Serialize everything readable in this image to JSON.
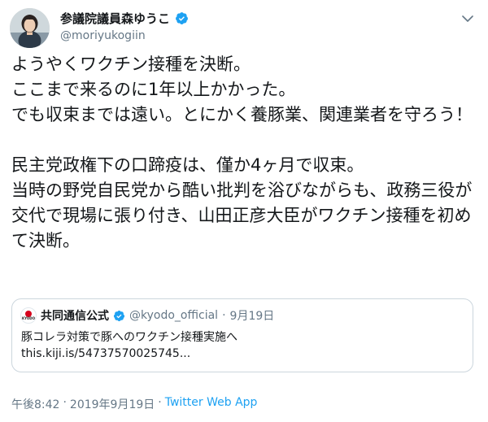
{
  "author": {
    "display_name": "参議院議員森ゆうこ",
    "handle": "@moriyukogiin"
  },
  "tweet": {
    "paragraphs": [
      "ようやくワクチン接種を決断。\nここまで来るのに1年以上かかった。\nでも収束までは遠い。とにかく養豚業、関連業者を守ろう！",
      "民主党政権下の口蹄疫は、僅か4ヶ月で収束。\n当時の野党自民党から酷い批判を浴びながらも、政務三役が交代で現場に張り付き、山田正彦大臣がワクチン接種を初めて決断。"
    ]
  },
  "quote": {
    "logo_text": "KYODO",
    "name": "共同通信公式",
    "handle": "@kyodo_official",
    "separator": "·",
    "date": "9月19日",
    "text": "豚コレラ対策で豚へのワクチン接種実施へ",
    "link": "this.kiji.is/54737570025745..."
  },
  "footer": {
    "time": "午後8:42",
    "dot1": "·",
    "date": "2019年9月19日",
    "dot2": "·",
    "app": "Twitter Web App"
  },
  "colors": {
    "verified": "#1da1f2",
    "link": "#1da1f2",
    "muted": "#657786",
    "kyodo_red": "#d6001c"
  },
  "icons": {
    "verified": "verified-badge-icon",
    "menu": "chevron-down-icon"
  }
}
